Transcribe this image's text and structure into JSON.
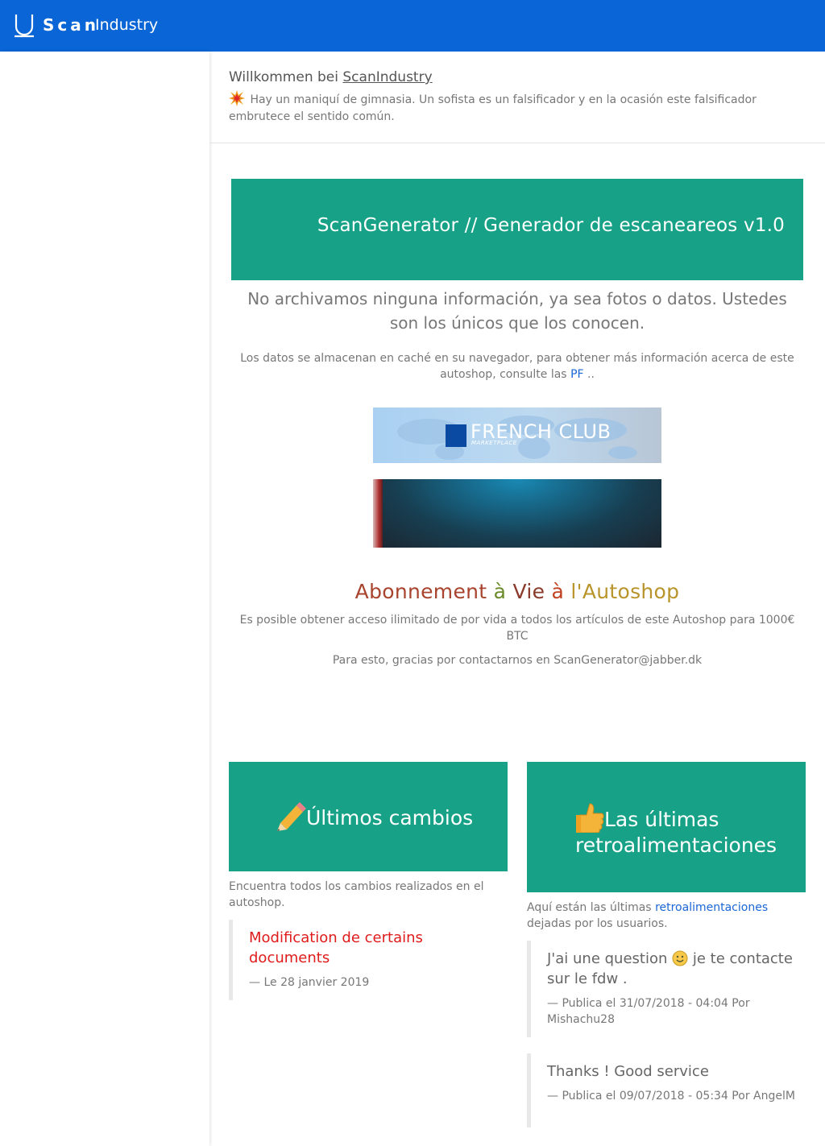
{
  "header": {
    "brand_scan": "Scan",
    "brand_industry": "Industry",
    "logo_icon": "u-logo-icon"
  },
  "welcome": {
    "prefix": "Willkommen bei",
    "link": "ScanIndustry",
    "text": "Hay un maniquí de gimnasia. Un sofista es un falsificador y en la ocasión este falsificador embrutece el sentido común.",
    "icon": "explosion-icon"
  },
  "banner": {
    "title": "ScanGenerator // Generador de escaneareos v1.0"
  },
  "lead": "No archivamos ninguna información, ya sea fotos o datos. Ustedes son los únicos que los conocen.",
  "cache_note": {
    "text": "Los datos se almacenan en caché en su navegador, para obtener más información acerca de este autoshop, consulte las",
    "link": "PF",
    "suffix": ".."
  },
  "ads": {
    "french_title": "FRENCH CLUB",
    "french_sub": "MARKETPLACE"
  },
  "abonnement": {
    "words": [
      {
        "text": "Abonnement",
        "color": "#a8432e"
      },
      {
        "text": " ",
        "color": "#a8432e"
      },
      {
        "text": "à",
        "color": "#6a8a2a"
      },
      {
        "text": " ",
        "color": "#a8432e"
      },
      {
        "text": "Vie",
        "color": "#8a3a2a"
      },
      {
        "text": " ",
        "color": "#a8432e"
      },
      {
        "text": "à",
        "color": "#c04020"
      },
      {
        "text": " ",
        "color": "#a8432e"
      },
      {
        "text": "l'Autoshop",
        "color": "#b8942a"
      }
    ],
    "note": "Es posible obtener acceso ilimitado de por vida a todos los artículos de este Autoshop para 1000€ BTC",
    "contact": "Para esto, gracias por contactarnos en ScanGenerator@jabber.dk"
  },
  "changes": {
    "title": "Últimos cambios",
    "icon": "pencil-icon",
    "desc": "Encuentra todos los cambios realizados en el autoshop.",
    "items": [
      {
        "title": "Modification de certains documents",
        "meta": "— Le 28 janvier 2019",
        "color": "#e01b1b"
      }
    ]
  },
  "feedback": {
    "title": "Las últimas retroalimentaciones",
    "icon": "thumbs-up-icon",
    "desc_prefix": "Aquí están las últimas",
    "desc_link": "retroalimentaciones",
    "desc_suffix": "dejadas por los usuarios.",
    "items": [
      {
        "title_a": "J'ai une question",
        "title_b": "je te contacte sur le fdw .",
        "meta": "— Publica el 31/07/2018 - 04:04 Por Mishachu28"
      },
      {
        "title": "Thanks ! Good service",
        "meta": "— Publica el 09/07/2018 - 05:34 Por AngelM"
      }
    ]
  }
}
